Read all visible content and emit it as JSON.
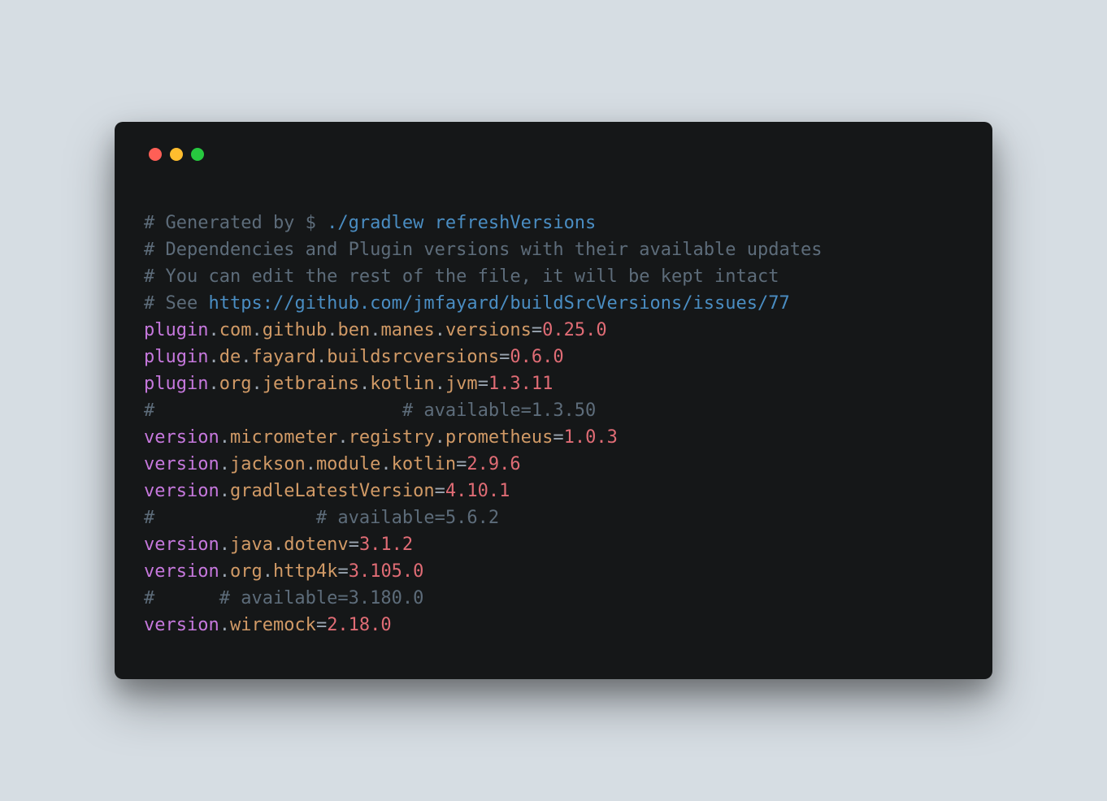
{
  "comments": {
    "line1_prefix": "# Generated by $ ",
    "line1_link": "./gradlew refreshVersions",
    "line2": "# Dependencies and Plugin versions with their available updates",
    "line3": "# You can edit the rest of the file, it will be kept intact",
    "line4_prefix": "# See ",
    "line4_link": "https://github.com/jmfayard/buildSrcVersions/issues/77",
    "avail1": "#                       # available=1.3.50",
    "avail2": "#               # available=5.6.2",
    "avail3": "#      # available=3.180.0"
  },
  "entries": [
    {
      "k1": "plugin",
      "k2": "com",
      "k3": "github",
      "k4": "ben",
      "k5": "manes",
      "k6": "versions",
      "val": "0.25.0"
    },
    {
      "k1": "plugin",
      "k2": "de",
      "k3": "fayard",
      "k4": "buildsrcversions",
      "val": "0.6.0"
    },
    {
      "k1": "plugin",
      "k2": "org",
      "k3": "jetbrains",
      "k4": "kotlin",
      "k5": "jvm",
      "val": "1.3.11"
    },
    {
      "k1": "version",
      "k2": "micrometer",
      "k3": "registry",
      "k4": "prometheus",
      "val": "1.0.3"
    },
    {
      "k1": "version",
      "k2": "jackson",
      "k3": "module",
      "k4": "kotlin",
      "val": "2.9.6"
    },
    {
      "k1": "version",
      "k2": "gradleLatestVersion",
      "val": "4.10.1"
    },
    {
      "k1": "version",
      "k2": "java",
      "k3": "dotenv",
      "val": "3.1.2"
    },
    {
      "k1": "version",
      "k2": "org",
      "k3": "http4k",
      "val": "3.105.0"
    },
    {
      "k1": "version",
      "k2": "wiremock",
      "val": "2.18.0"
    }
  ]
}
